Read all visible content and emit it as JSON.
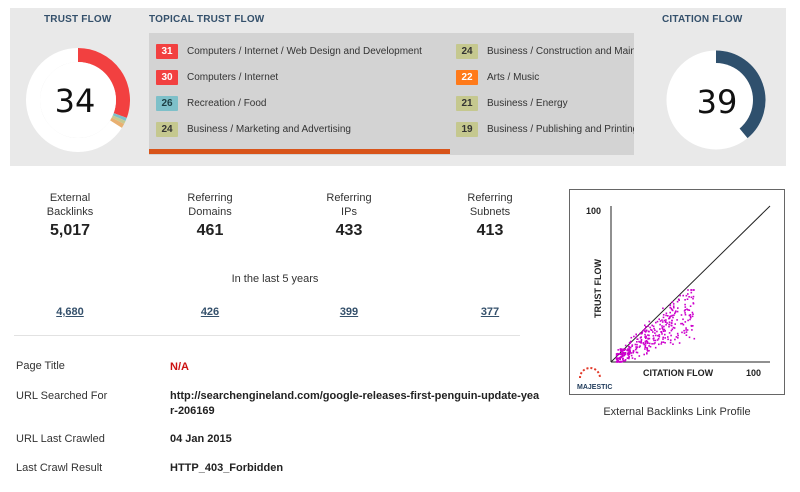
{
  "trust_flow": {
    "heading": "TRUST FLOW",
    "value": "34",
    "score": 34,
    "ring_color": "#f24040"
  },
  "topical_trust_flow": {
    "heading": "TOPICAL TRUST FLOW",
    "topics": [
      {
        "score": "31",
        "label": "Computers / Internet / Web Design and Development",
        "badge_color": "#f24040",
        "text_color": "#ffffff"
      },
      {
        "score": "30",
        "label": "Computers / Internet",
        "badge_color": "#f24040",
        "text_color": "#ffffff"
      },
      {
        "score": "26",
        "label": "Recreation / Food",
        "badge_color": "#7ec0c9",
        "text_color": "#1d3f44"
      },
      {
        "score": "24",
        "label": "Business / Marketing and Advertising",
        "badge_color": "#c5c88f",
        "text_color": "#333333"
      },
      {
        "score": "24",
        "label": "Business / Construction and Main",
        "badge_color": "#c5c88f",
        "text_color": "#333333"
      },
      {
        "score": "22",
        "label": "Arts / Music",
        "badge_color": "#ff7a1a",
        "text_color": "#ffffff"
      },
      {
        "score": "21",
        "label": "Business / Energy",
        "badge_color": "#c5c88f",
        "text_color": "#333333"
      },
      {
        "score": "19",
        "label": "Business / Publishing and Printing",
        "badge_color": "#c5c88f",
        "text_color": "#333333"
      }
    ],
    "scroll_progress": 0.62,
    "scroll_color": "#d8541a"
  },
  "citation_flow": {
    "heading": "CITATION FLOW",
    "value": "39",
    "score": 39,
    "ring_color": "#2f506d"
  },
  "stats": [
    {
      "label_line1": "External",
      "label_line2": "Backlinks",
      "value": "5,017",
      "sub_value": "4,680"
    },
    {
      "label_line1": "Referring",
      "label_line2": "Domains",
      "value": "461",
      "sub_value": "426"
    },
    {
      "label_line1": "Referring",
      "label_line2": "IPs",
      "value": "433",
      "sub_value": "399"
    },
    {
      "label_line1": "Referring",
      "label_line2": "Subnets",
      "value": "413",
      "sub_value": "377"
    }
  ],
  "timeframe_label": "In the last 5 years",
  "details": {
    "page_title_label": "Page Title",
    "page_title_value": "N/A",
    "url_searched_label": "URL Searched For",
    "url_searched_value": "http://searchengineland.com/google-releases-first-penguin-update-year-206169",
    "url_crawled_label": "URL Last Crawled",
    "url_crawled_value": "04 Jan 2015",
    "crawl_result_label": "Last Crawl Result",
    "crawl_result_value": "HTTP_403_Forbidden"
  },
  "link_profile": {
    "caption": "External Backlinks Link Profile",
    "logo_text": "MAJESTIC",
    "chart_data": {
      "type": "scatter",
      "xlabel": "CITATION FLOW",
      "ylabel": "TRUST FLOW",
      "x_max_label": "100",
      "y_max_label": "100",
      "xlim": [
        0,
        100
      ],
      "ylim": [
        0,
        100
      ],
      "point_color": "#cc00cc",
      "reference_line": "diagonal",
      "approx_points": 400,
      "cluster_x_range": [
        3,
        52
      ],
      "cluster_y_range": [
        0,
        46
      ]
    }
  }
}
